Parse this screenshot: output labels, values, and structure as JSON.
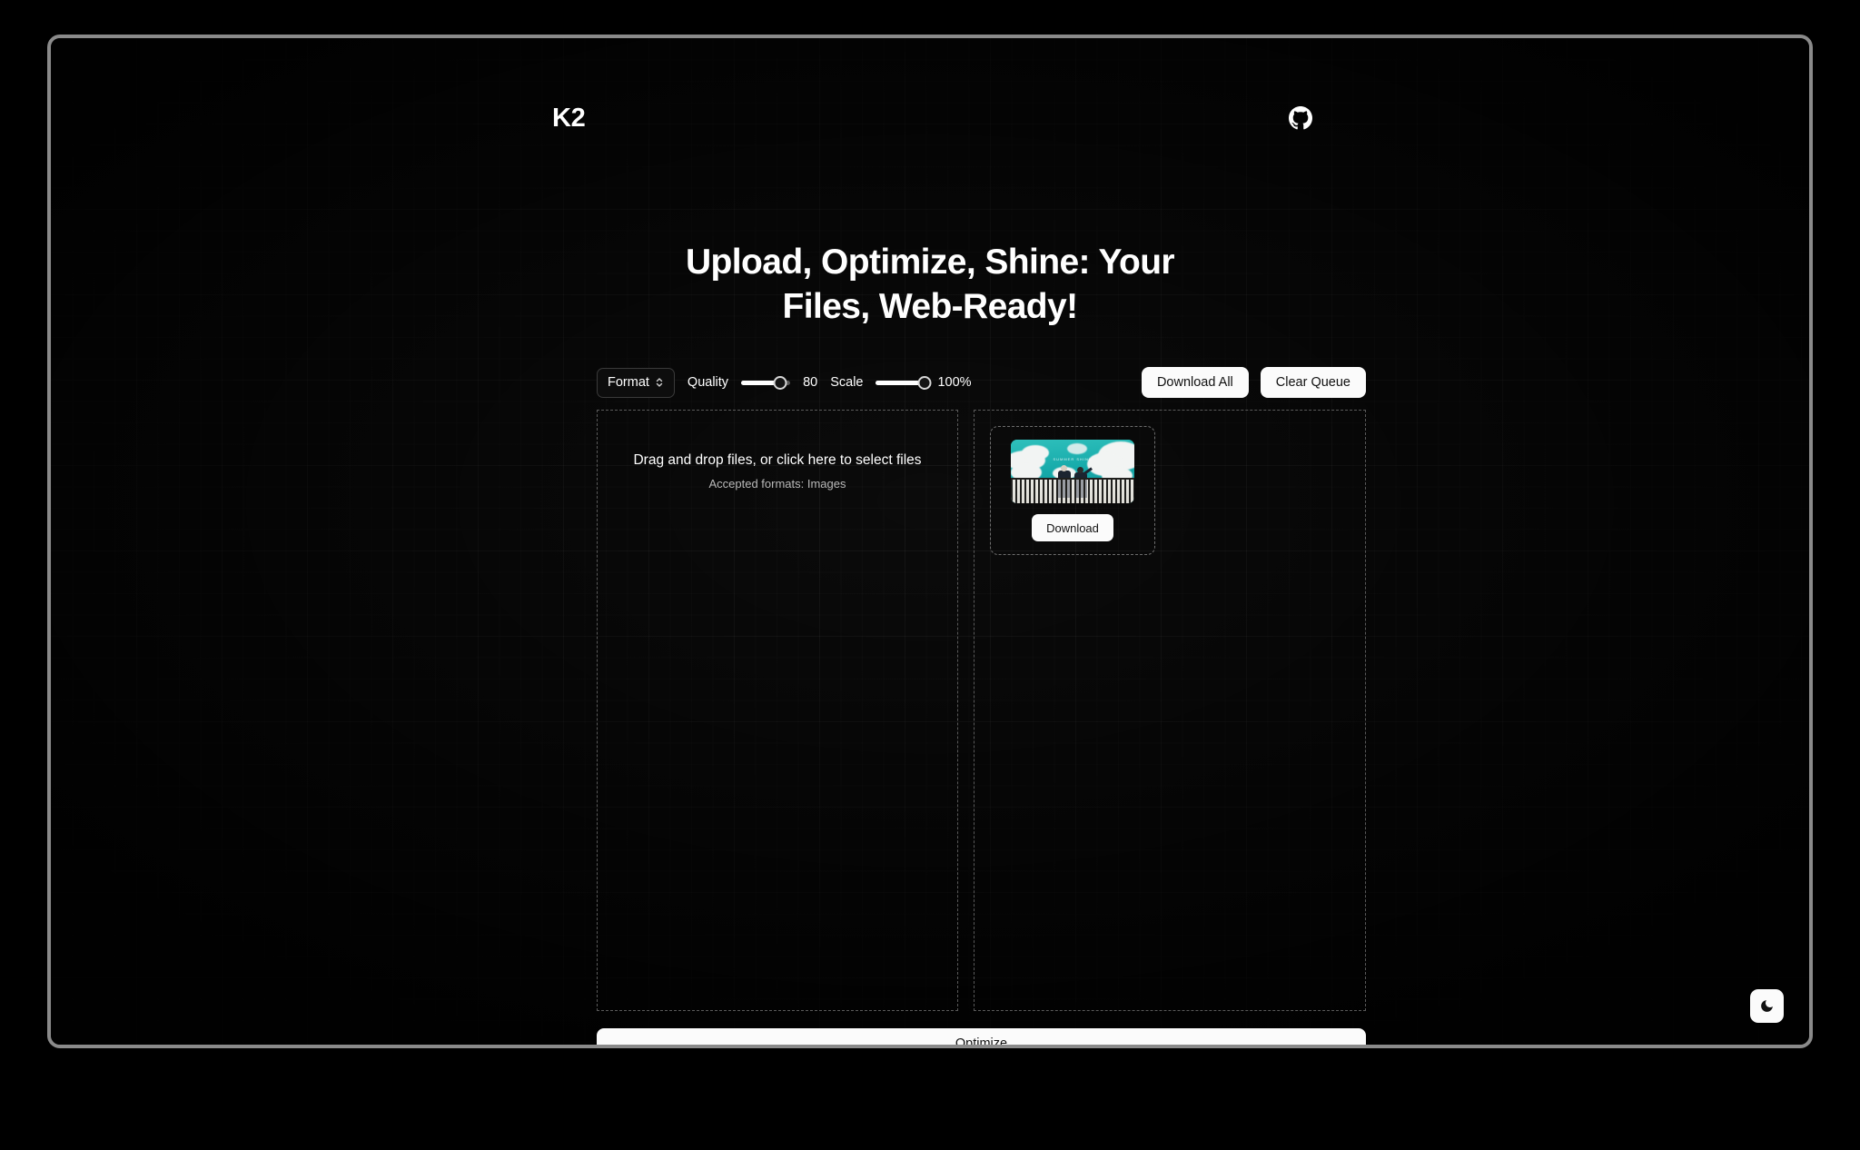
{
  "header": {
    "logo": "K2",
    "github_icon": "github-icon"
  },
  "hero": {
    "heading_line1": "Upload, Optimize, Shine: Your",
    "heading_line2": "Files, Web-Ready!"
  },
  "toolbar": {
    "format_label": "Format",
    "format_chevron_icon": "chevron-up-down-icon",
    "quality_label": "Quality",
    "quality_value": "80",
    "quality_percent": 80,
    "scale_label": "Scale",
    "scale_value": "100%",
    "scale_percent": 100,
    "download_all_label": "Download All",
    "clear_queue_label": "Clear Queue"
  },
  "dropzone": {
    "primary_text": "Drag and drop files, or click here to select files",
    "secondary_text": "Accepted formats: Images"
  },
  "queue": {
    "items": [
      {
        "thumbnail_overlay_text": "SUMMER SHINE",
        "download_label": "Download"
      }
    ]
  },
  "actions": {
    "optimize_label": "Optimize"
  },
  "theme": {
    "toggle_icon": "moon-icon"
  },
  "colors": {
    "page_background": "#000000",
    "app_background": "#0b0b0b",
    "frame_border": "#8a8a8a",
    "button_light": "#fbfbfb",
    "button_text": "#111111",
    "text_primary": "#ffffff",
    "text_muted": "#b9b9b9",
    "dashed_border": "#5a5a5a",
    "thumbnail_accent": "#18b0ae"
  }
}
